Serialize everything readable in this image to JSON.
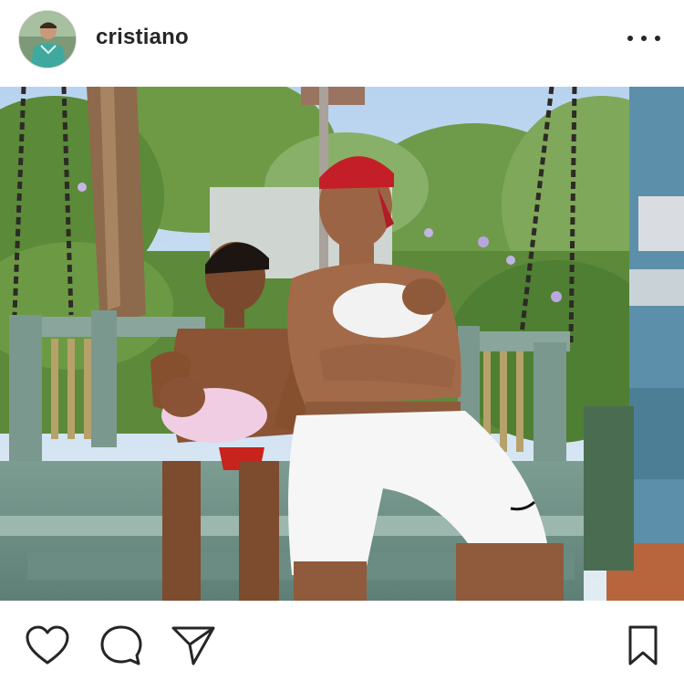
{
  "post": {
    "username": "cristiano",
    "avatar_icon": "profile-photo",
    "more_icon": "more-options-icon"
  },
  "photo": {
    "description_icon": "photo-swing-garden",
    "colors": {
      "sky": "#bcd6ee",
      "foliage": "#5f8a3e",
      "bench": "#7d9c93",
      "cap": "#c51f2a",
      "shorts": "#f4f4f4"
    }
  },
  "actions": {
    "like_icon": "heart-icon",
    "comment_icon": "comment-icon",
    "share_icon": "share-icon",
    "save_icon": "bookmark-icon"
  }
}
